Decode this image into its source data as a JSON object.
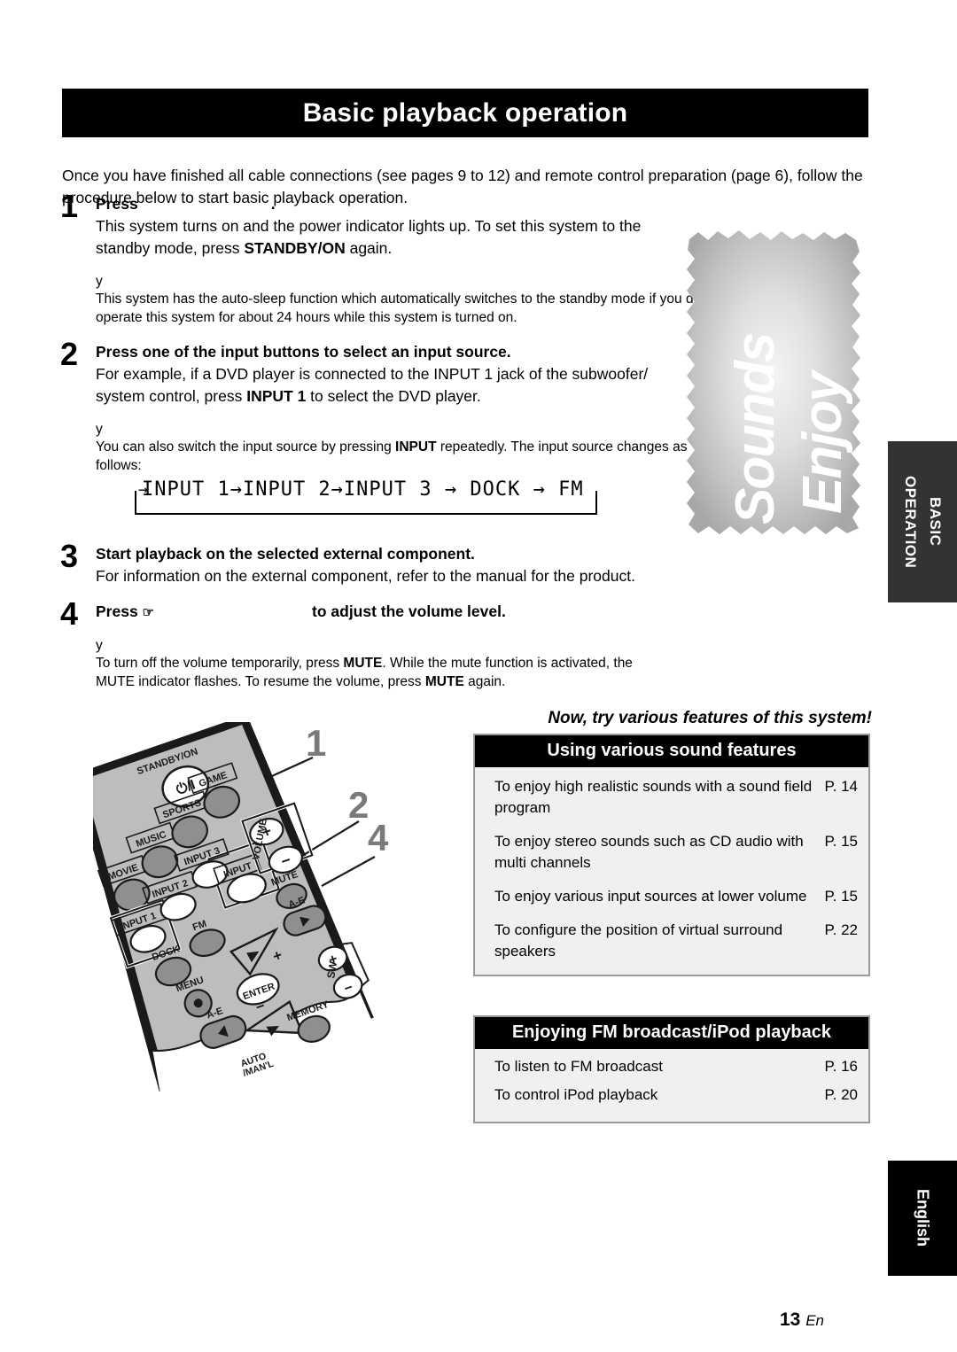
{
  "header": {
    "title": "Basic playback operation"
  },
  "intro": {
    "text": "Once you have finished all cable connections (see pages 9 to 12) and remote control preparation (page 6), follow the procedure below to start basic playback operation."
  },
  "steps": [
    {
      "number": "1",
      "heading_prefix": "Press",
      "heading_suffix": ".",
      "desc_1": "This system turns on and the power indicator lights up. To set this system to the",
      "desc_2_a": "standby mode, press ",
      "desc_2_b": "STANDBY/ON",
      "desc_2_c": " again.",
      "tip_mark": "y",
      "tip_text": "This system has the auto-sleep function which automatically switches to the standby mode if you do not operate this system for about 24 hours while this system is turned on."
    },
    {
      "number": "2",
      "heading": "Press one of the input buttons to select an input source.",
      "desc_1": "For example, if a DVD player is connected to the INPUT 1 jack of the subwoofer/",
      "desc_2_a": "system control, press ",
      "desc_2_b": "INPUT 1",
      "desc_2_c": " to select the DVD player.",
      "tip_mark": "y",
      "tip_a": "You can also switch the input source by pressing ",
      "tip_b": "INPUT",
      "tip_c": " repeatedly. The input source changes as follows:"
    },
    {
      "number": "3",
      "heading": "Start playback on the selected external component.",
      "desc_1": "For information on the external component, refer to the manual for the product."
    },
    {
      "number": "4",
      "heading_prefix": "Press",
      "heading_icon": "pointing-hand-icon",
      "heading_icon_glyph": "☞",
      "heading_suffix": "to adjust the volume level.",
      "tip_mark": "y",
      "tip_1_a": "To turn off the volume temporarily, press ",
      "tip_1_b": "MUTE",
      "tip_1_c": ". While the mute function is activated, the",
      "tip_2_a": "MUTE indicator flashes. To resume the volume, press ",
      "tip_2_b": "MUTE",
      "tip_2_c": " again."
    }
  ],
  "input_cycle": {
    "chain": "INPUT 1→INPUT 2→INPUT 3 → DOCK → FM",
    "loop_arrow": "→",
    "items": [
      "INPUT 1",
      "INPUT 2",
      "INPUT 3",
      "DOCK",
      "FM"
    ]
  },
  "enjoy_graphic": {
    "line1": "Enjoy",
    "line2": "Sounds"
  },
  "side_tabs": {
    "basic_operation": "BASIC\nOPERATION",
    "basic_operation_line1": "BASIC",
    "basic_operation_line2": "OPERATION",
    "english": "English"
  },
  "now_try": {
    "text": "Now, try various features of this system!"
  },
  "tables": [
    {
      "id": "sound",
      "title": "Using various sound features",
      "rows": [
        {
          "text": "To enjoy high realistic sounds with a sound field program",
          "page": "P. 14"
        },
        {
          "text": "To enjoy stereo sounds such as CD audio with multi channels",
          "page": "P. 15"
        },
        {
          "text": "To enjoy various input sources at lower volume",
          "page": "P. 15"
        },
        {
          "text": "To configure the position of virtual surround speakers",
          "page": "P. 22"
        }
      ]
    },
    {
      "id": "fm",
      "title": "Enjoying FM broadcast/iPod playback",
      "rows": [
        {
          "text": "To listen to FM broadcast",
          "page": "P. 16"
        },
        {
          "text": "To control iPod playback",
          "page": "P. 20"
        }
      ]
    }
  ],
  "remote": {
    "callouts": [
      {
        "label": "1"
      },
      {
        "label": "2"
      },
      {
        "label": "4"
      }
    ],
    "buttons": {
      "standby_on": "STANDBY/ON",
      "power_glyph": "⏻/I",
      "movie": "MOVIE",
      "music": "MUSIC",
      "sports": "SPORTS",
      "game": "GAME",
      "input_1": "INPUT 1",
      "input_2": "INPUT 2",
      "input_3": "INPUT 3",
      "input": "INPUT",
      "dock": "DOCK",
      "fm": "FM",
      "volume": "VOLUME",
      "volume_plus": "+",
      "volume_minus": "−",
      "mute": "MUTE",
      "menu": "MENU",
      "enter": "ENTER",
      "a_e_upper": "A-E",
      "a_e_lower": "A-E",
      "auto_manl_1": "AUTO",
      "auto_manl_2": "/MAN'L",
      "memory": "MEMORY",
      "sw": "SW",
      "sw_plus": "+",
      "sw_minus": "−",
      "tuning_plus": "+",
      "tuning_minus": "−"
    }
  },
  "footer": {
    "page_number": "13",
    "language_code": "En"
  },
  "colors": {
    "header_bg": "#000000",
    "tab_basic_bg": "#333333",
    "tab_english_bg": "#000000",
    "table_head_bg": "#000000",
    "table_body_bg": "#f0f0f0",
    "table_border": "#9a9a9a",
    "callout_gray": "#7a7a7a",
    "remote_body": "#b8b8b8"
  }
}
